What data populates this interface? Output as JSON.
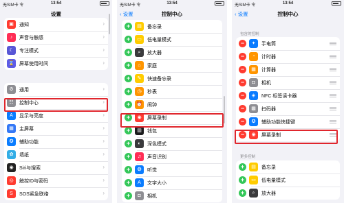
{
  "p1": {
    "carrier": "无SIM卡 令",
    "time": "13:54",
    "title": "设置",
    "group1": [
      {
        "label": "通知",
        "icon": "bell-icon",
        "color": "#ff3b30",
        "glyph": "▣"
      },
      {
        "label": "声音与触感",
        "icon": "speaker-icon",
        "color": "#ff2d55",
        "glyph": "♪"
      },
      {
        "label": "专注模式",
        "icon": "moon-icon",
        "color": "#5856d6",
        "glyph": "☾"
      },
      {
        "label": "屏幕使用时间",
        "icon": "hourglass-icon",
        "color": "#5e5ce6",
        "glyph": "⌛"
      }
    ],
    "group2": [
      {
        "label": "通用",
        "icon": "gear-icon",
        "color": "#8e8e93",
        "glyph": "⚙"
      },
      {
        "label": "控制中心",
        "icon": "toggles-icon",
        "color": "#8e8e93",
        "glyph": "☷"
      },
      {
        "label": "显示与亮度",
        "icon": "aa-icon",
        "color": "#0a7cff",
        "glyph": "A"
      },
      {
        "label": "主屏幕",
        "icon": "home-grid-icon",
        "color": "#3478f6",
        "glyph": "▦"
      },
      {
        "label": "辅助功能",
        "icon": "accessibility-icon",
        "color": "#0a7cff",
        "glyph": "✪"
      },
      {
        "label": "墙纸",
        "icon": "flower-icon",
        "color": "#32ade6",
        "glyph": "✿"
      },
      {
        "label": "Siri与搜索",
        "icon": "siri-icon",
        "color": "#222",
        "glyph": "◉"
      },
      {
        "label": "触控ID与密码",
        "icon": "fingerprint-icon",
        "color": "#ff3b30",
        "glyph": "◎"
      },
      {
        "label": "SOS紧急联络",
        "icon": "sos-icon",
        "color": "#ff3b30",
        "glyph": "S"
      }
    ]
  },
  "p2": {
    "carrier": "无SIM卡 令",
    "time": "13:54",
    "title": "控制中心",
    "back": "设置",
    "items": [
      {
        "label": "备忘录",
        "icon": "notes-icon",
        "color": "#ffcc00",
        "glyph": "▤"
      },
      {
        "label": "低电量模式",
        "icon": "battery-icon",
        "color": "#ffcc00",
        "glyph": "▭"
      },
      {
        "label": "放大器",
        "icon": "magnifier-icon",
        "color": "#3a3a3c",
        "glyph": "⌕"
      },
      {
        "label": "家庭",
        "icon": "house-icon",
        "color": "#ff9500",
        "glyph": "⌂"
      },
      {
        "label": "快速备忘录",
        "icon": "quick-note-icon",
        "color": "#ffcc00",
        "glyph": "✎"
      },
      {
        "label": "秒表",
        "icon": "stopwatch-icon",
        "color": "#ff9500",
        "glyph": "◷"
      },
      {
        "label": "闹钟",
        "icon": "alarm-icon",
        "color": "#ff9500",
        "glyph": "⏰"
      },
      {
        "label": "屏幕录制",
        "icon": "record-icon",
        "color": "#ff3b30",
        "glyph": "◉"
      },
      {
        "label": "钱包",
        "icon": "wallet-icon",
        "color": "#1c1c1e",
        "glyph": "▥"
      },
      {
        "label": "深色模式",
        "icon": "dark-mode-icon",
        "color": "#3a3a3c",
        "glyph": "◐"
      },
      {
        "label": "声音识别",
        "icon": "sound-wave-icon",
        "color": "#ff2d55",
        "glyph": "♫"
      },
      {
        "label": "听觉",
        "icon": "ear-icon",
        "color": "#0a7cff",
        "glyph": "❂"
      },
      {
        "label": "文字大小",
        "icon": "text-size-icon",
        "color": "#0a7cff",
        "glyph": "A"
      },
      {
        "label": "相机",
        "icon": "camera-icon",
        "color": "#8e8e93",
        "glyph": "◘"
      }
    ]
  },
  "p3": {
    "carrier": "无SIM卡 令",
    "time": "13:54",
    "title": "控制中心",
    "back": "设置",
    "section_included": "包含的控制",
    "section_more": "更多控制",
    "included": [
      {
        "label": "手电筒",
        "icon": "flashlight-icon",
        "color": "#0a7cff",
        "glyph": "✦"
      },
      {
        "label": "计时器",
        "icon": "timer-icon",
        "color": "#ff9500",
        "glyph": "◔"
      },
      {
        "label": "计算器",
        "icon": "calculator-icon",
        "color": "#ff9500",
        "glyph": "▦"
      },
      {
        "label": "相机",
        "icon": "camera-icon",
        "color": "#8e8e93",
        "glyph": "◘"
      },
      {
        "label": "NFC 标签读卡器",
        "icon": "nfc-icon",
        "color": "#0a7cff",
        "glyph": "◈"
      },
      {
        "label": "扫码器",
        "icon": "qr-icon",
        "color": "#8e8e93",
        "glyph": "▩"
      },
      {
        "label": "辅助功能快捷键",
        "icon": "accessibility-icon",
        "color": "#0a7cff",
        "glyph": "✪"
      },
      {
        "label": "屏幕录制",
        "icon": "record-icon",
        "color": "#ff3b30",
        "glyph": "◉"
      }
    ],
    "more": [
      {
        "label": "备忘录",
        "icon": "notes-icon",
        "color": "#ffcc00",
        "glyph": "▤"
      },
      {
        "label": "低电量模式",
        "icon": "battery-icon",
        "color": "#ffcc00",
        "glyph": "▭"
      },
      {
        "label": "放大器",
        "icon": "magnifier-icon",
        "color": "#3a3a3c",
        "glyph": "⌕"
      }
    ]
  },
  "highlight_color": "#e0262d",
  "accent": "#0a7cff"
}
